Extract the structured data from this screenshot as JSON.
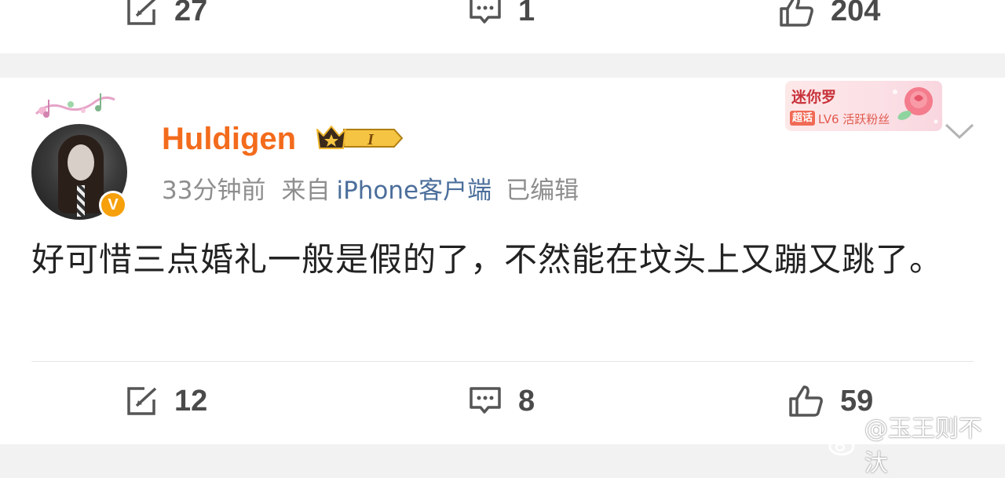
{
  "previous_post": {
    "repost_count": "27",
    "comment_count": "1",
    "like_count": "204"
  },
  "post": {
    "username": "Huldigen",
    "member_level": "I",
    "time": "33分钟前",
    "from_label": "来自",
    "source": "iPhone客户端",
    "edited": "已编辑",
    "text": "好可惜三点婚礼一般是假的了，不然能在坟头上又蹦又跳了。",
    "repost_count": "12",
    "comment_count": "8",
    "like_count": "59"
  },
  "fan_badge": {
    "name": "迷你罗",
    "tag": "超话",
    "level": "LV6 活跃粉丝"
  },
  "verified_mark": "V",
  "watermark": "@玉王则不汏",
  "colors": {
    "username": "#f36b1c",
    "source_link": "#4b6e9b",
    "meta": "#8e8e8e",
    "verified": "#f6a00c"
  },
  "icons": [
    "repost-icon",
    "comment-icon",
    "like-icon",
    "chevron-down-icon",
    "crown-icon",
    "rose-icon",
    "weibo-logo-icon"
  ]
}
